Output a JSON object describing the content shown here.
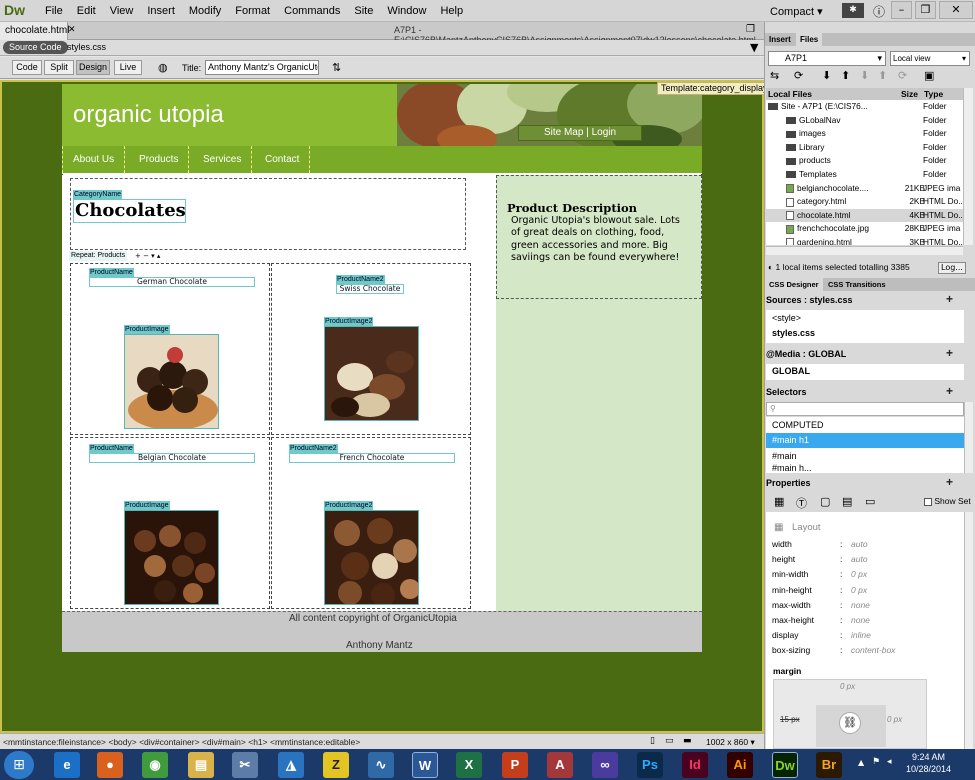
{
  "app": {
    "logo": "Dw",
    "menu": [
      "File",
      "Edit",
      "View",
      "Insert",
      "Modify",
      "Format",
      "Commands",
      "Site",
      "Window",
      "Help"
    ],
    "workspace": "Compact",
    "doc_tab": "chocolate.html",
    "doc_path": "A7P1 - E:\\CIS76B\\MantzAnthonyCIS76B\\Assignments\\Assignment07\\dw12lessons\\chocolate.html",
    "source_code": "Source Code",
    "related_file": "styles.css"
  },
  "view_toolbar": {
    "code": "Code",
    "split": "Split",
    "design": "Design",
    "live": "Live",
    "title_label": "Title:",
    "title_value": "Anthony Mantz's OrganicUtopia"
  },
  "page": {
    "template_tag": "Template:category_display",
    "site_title": "organic utopia",
    "sitemap": "Site Map | Login",
    "nav": [
      "About Us",
      "Products",
      "Services",
      "Contact"
    ],
    "category_label": "CategoryName",
    "category_title": "Chocolates",
    "repeat_label": "Repeat: Products",
    "repeat_controls": "+ − ▾ ▴",
    "products": [
      {
        "name_label": "ProductName",
        "name": "German Chocolate",
        "image_label": "ProductImage"
      },
      {
        "name_label": "ProductName2",
        "name": "Swiss Chocolate",
        "image_label": "ProductImage2"
      },
      {
        "name_label": "ProductName",
        "name": "Belgian Chocolate",
        "image_label": "ProductImage"
      },
      {
        "name_label": "ProductName2",
        "name": "French Chocolate",
        "image_label": "ProductImage2"
      }
    ],
    "desc_title": "Product Description",
    "desc_text": "Organic Utopia's blowout sale. Lots of great deals on clothing, food, green accessories and more. Big saviings can be found everywhere!",
    "footer_line1": "All content copyright of OrganicUtopia",
    "footer_line2": "Anthony Mantz"
  },
  "status_bar": {
    "tag_path": "<mmtinstance:fileinstance> <body> <div#container> <div#main> <h1> <mmtinstance:editable>",
    "size": "1002 x 860"
  },
  "files_panel": {
    "tab_insert": "Insert",
    "tab_files": "Files",
    "site": "A7P1",
    "view": "Local view",
    "header_name": "Local Files",
    "header_size": "Size",
    "header_type": "Type",
    "rows": [
      {
        "name": "Site - A7P1 (E:\\CIS76...",
        "size": "",
        "type": "Folder",
        "kind": "folder",
        "indent": 0
      },
      {
        "name": "GLobalNav",
        "size": "",
        "type": "Folder",
        "kind": "folder",
        "indent": 1
      },
      {
        "name": "images",
        "size": "",
        "type": "Folder",
        "kind": "folder",
        "indent": 1
      },
      {
        "name": "Library",
        "size": "",
        "type": "Folder",
        "kind": "folder",
        "indent": 1
      },
      {
        "name": "products",
        "size": "",
        "type": "Folder",
        "kind": "folder",
        "indent": 1
      },
      {
        "name": "Templates",
        "size": "",
        "type": "Folder",
        "kind": "folder",
        "indent": 1
      },
      {
        "name": "belgianchocolate....",
        "size": "21KB",
        "type": "JPEG ima",
        "kind": "image",
        "indent": 1
      },
      {
        "name": "category.html",
        "size": "2KB",
        "type": "HTML Do...",
        "kind": "file",
        "indent": 1
      },
      {
        "name": "chocolate.html",
        "size": "4KB",
        "type": "HTML Do...",
        "kind": "file",
        "indent": 1,
        "selected": true
      },
      {
        "name": "frenchchocolate.jpg",
        "size": "28KB",
        "type": "JPEG ima",
        "kind": "image",
        "indent": 1
      },
      {
        "name": "gardening.html",
        "size": "3KB",
        "type": "HTML Do...",
        "kind": "file",
        "indent": 1
      }
    ],
    "status": "1 local items selected totalling 3385",
    "log": "Log..."
  },
  "css_panel": {
    "tab_designer": "CSS Designer",
    "tab_transitions": "CSS Transitions",
    "sources_title": "Sources : styles.css",
    "sources": [
      "<style>",
      "styles.css"
    ],
    "media_title": "@Media : GLOBAL",
    "media": "GLOBAL",
    "selectors_title": "Selectors",
    "selectors": [
      "COMPUTED",
      "#main h1",
      "#main",
      "#main h..."
    ],
    "properties_title": "Properties",
    "show_set": "Show Set",
    "layout_title": "Layout",
    "props": [
      {
        "name": "width",
        "value": "auto"
      },
      {
        "name": "height",
        "value": "auto"
      },
      {
        "name": "min-width",
        "value": "0 px"
      },
      {
        "name": "min-height",
        "value": "0 px"
      },
      {
        "name": "max-width",
        "value": "none"
      },
      {
        "name": "max-height",
        "value": "none"
      },
      {
        "name": "display",
        "value": "inline"
      },
      {
        "name": "box-sizing",
        "value": "content-box"
      }
    ],
    "margin_title": "margin",
    "margin_top": "0 px",
    "margin_left": "15 px",
    "margin_right": "0 px"
  },
  "taskbar": {
    "time": "9:24 AM",
    "date": "10/28/2014"
  },
  "colors": {
    "canvas_bg": "#4b6b13",
    "header_green": "#8bbb30",
    "nav_green": "#7aab26",
    "side_bg": "#d4e7c6",
    "selection_blue": "#3aa8ee"
  }
}
